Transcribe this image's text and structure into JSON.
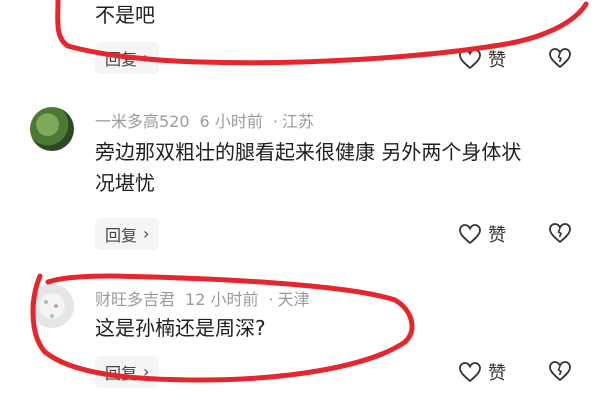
{
  "comments": [
    {
      "author": "",
      "time": "",
      "location": "",
      "text": "不是吧",
      "reply_label": "回复",
      "like_label": "赞"
    },
    {
      "author": "一米多高520",
      "time": "6 小时前",
      "location": "江苏",
      "text": "旁边那双粗壮的腿看起来很健康 另外两个身体状况堪忧",
      "reply_label": "回复",
      "like_label": "赞"
    },
    {
      "author": "财旺多吉君",
      "time": "12 小时前",
      "location": "天津",
      "text": "这是孙楠还是周深?",
      "reply_label": "回复",
      "like_label": "赞"
    }
  ],
  "separator": "·",
  "colors": {
    "annotation_red": "#e5262d",
    "meta_gray": "#9b9b9b"
  },
  "icons": {
    "like": "heart-outline-icon",
    "dislike": "broken-heart-icon",
    "reply_arrow": "chevron-right-icon"
  }
}
